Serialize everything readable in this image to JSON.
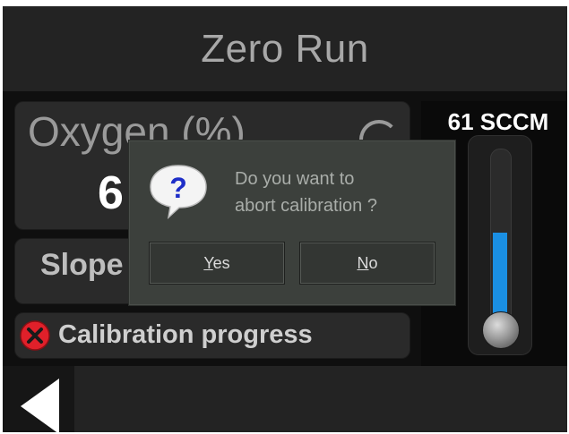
{
  "header": {
    "title": "Zero Run"
  },
  "oxygen": {
    "label": "Oxygen (%)",
    "value": "6"
  },
  "slope": {
    "label": "Slope"
  },
  "progress": {
    "label": "Calibration progress",
    "status_icon": "error-x-icon",
    "status_color": "#e0202a"
  },
  "flow": {
    "value": "61 SCCM",
    "level": 0.55,
    "fill_color": "#1a8fe3"
  },
  "dialog": {
    "icon": "question-bubble-icon",
    "message_line1": "Do you want to",
    "message_line2": "abort calibration ?",
    "yes_mnemonic": "Y",
    "yes_rest": "es",
    "no_mnemonic": "N",
    "no_rest": "o"
  },
  "footer": {
    "back_icon": "back-arrow-icon"
  }
}
